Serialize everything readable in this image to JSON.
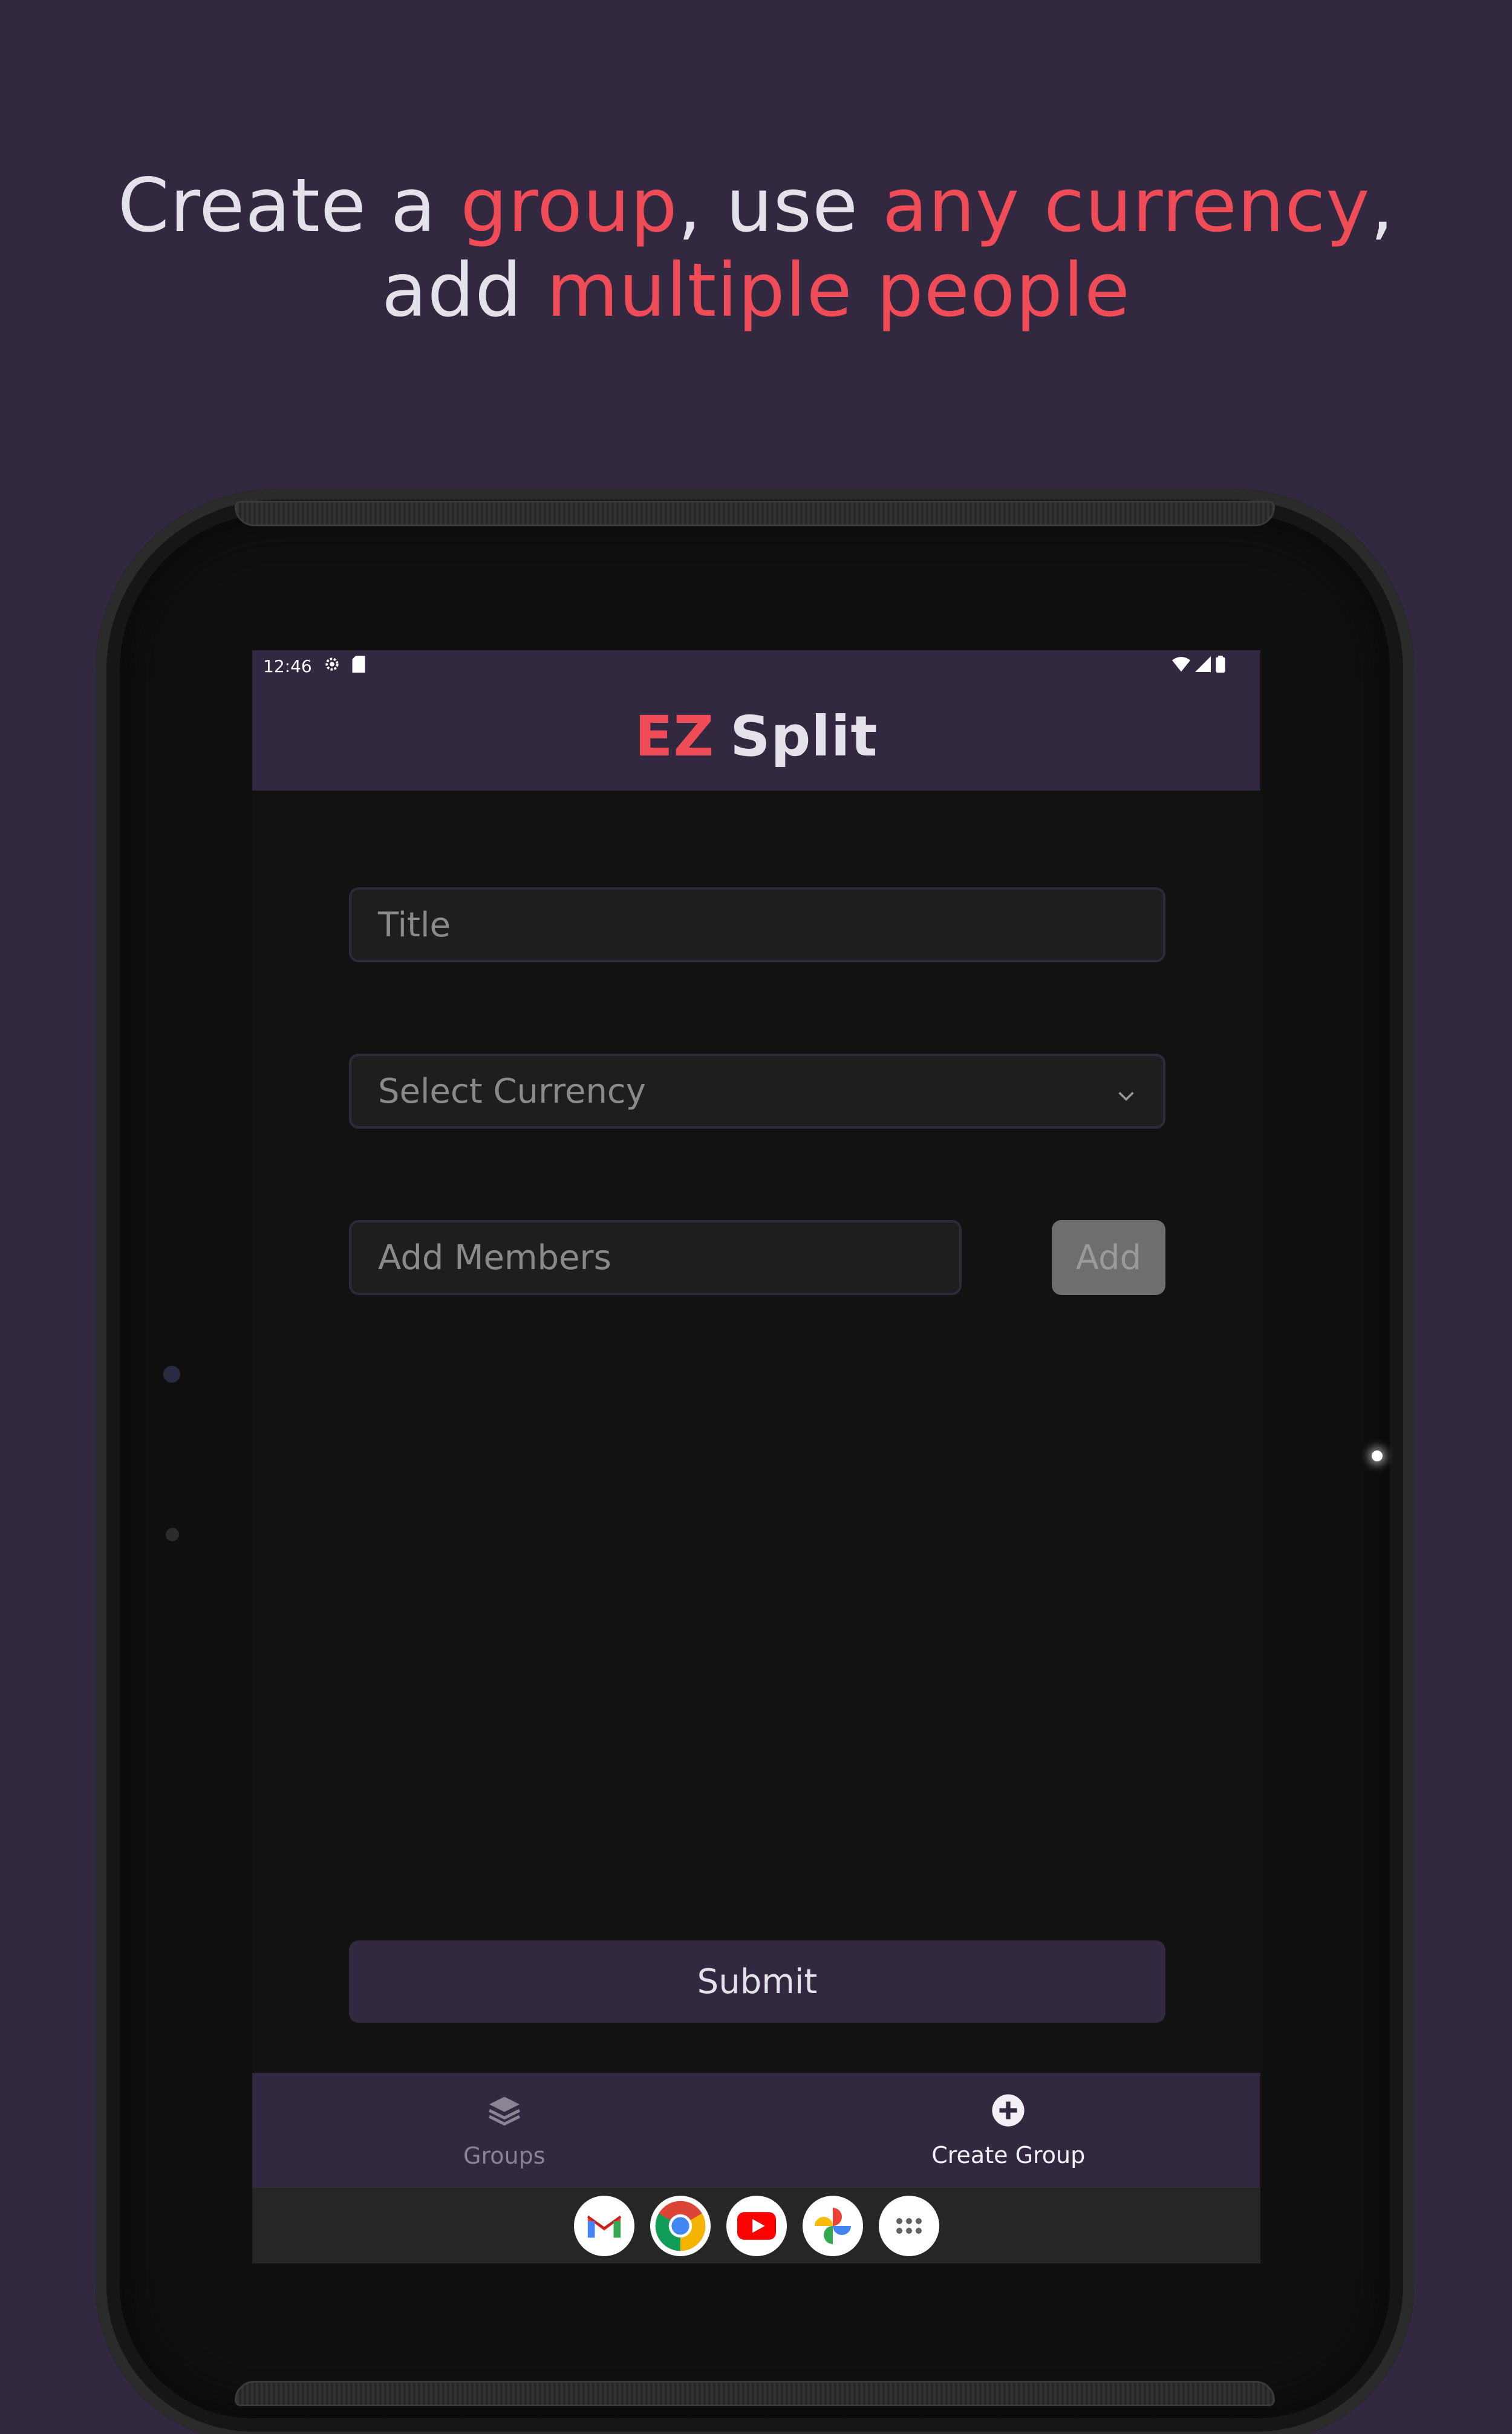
{
  "headline": {
    "line1_a": "Create a ",
    "line1_b": "group",
    "line1_c": ", use ",
    "line1_d": "any currency",
    "line1_e": ",",
    "line2_a": "add ",
    "line2_b": "multiple people"
  },
  "status_bar": {
    "time": "12:46"
  },
  "app_bar": {
    "title_accent": "EZ",
    "title_main": "Split"
  },
  "form": {
    "title_placeholder": "Title",
    "currency_placeholder": "Select Currency",
    "members_placeholder": "Add Members",
    "add_label": "Add",
    "submit_label": "Submit"
  },
  "bottom_nav": {
    "items": [
      {
        "label": "Groups",
        "icon": "layers-icon",
        "active": false
      },
      {
        "label": "Create Group",
        "icon": "plus-circle-icon",
        "active": true
      }
    ]
  },
  "dock": {
    "apps": [
      "gmail-icon",
      "chrome-icon",
      "youtube-icon",
      "photos-icon",
      "app-drawer-icon"
    ]
  },
  "colors": {
    "background": "#322840",
    "accent": "#ef4c58",
    "screen": "#121212",
    "text_light": "#e4e1ea"
  }
}
